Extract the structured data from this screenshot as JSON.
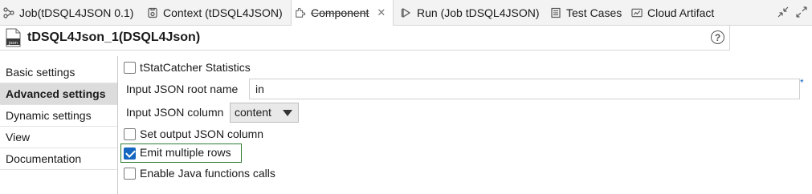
{
  "tabs": [
    {
      "label": "Job(tDSQL4JSON 0.1)",
      "icon": "job-icon",
      "active": false
    },
    {
      "label": "Context (tDSQL4JSON)",
      "icon": "context-icon",
      "active": false
    },
    {
      "label": "Component",
      "icon": "component-icon",
      "active": true
    },
    {
      "label": "Run (Job tDSQL4JSON)",
      "icon": "run-icon",
      "active": false
    },
    {
      "label": "Test Cases",
      "icon": "test-cases-icon",
      "active": false
    },
    {
      "label": "Cloud Artifact",
      "icon": "cloud-artifact-icon",
      "active": false
    }
  ],
  "tab_close": "✕",
  "component": {
    "title": "tDSQL4Json_1(DSQL4Json)",
    "icon_text": "DSQL",
    "help": "?"
  },
  "side_tabs": [
    {
      "label": "Basic settings",
      "active": false
    },
    {
      "label": "Advanced settings",
      "active": true
    },
    {
      "label": "Dynamic settings",
      "active": false
    },
    {
      "label": "View",
      "active": false
    },
    {
      "label": "Documentation",
      "active": false
    }
  ],
  "settings": {
    "tstatcatcher_label": "tStatCatcher Statistics",
    "tstatcatcher_checked": false,
    "root_name_label": "Input JSON root name",
    "root_name_value": "in",
    "required_marker": "*",
    "json_column_label": "Input JSON column",
    "json_column_value": "content",
    "set_output_label": "Set output JSON column",
    "set_output_checked": false,
    "emit_rows_label": "Emit multiple rows",
    "emit_rows_checked": true,
    "java_calls_label": "Enable Java functions calls",
    "java_calls_checked": false
  },
  "colors": {
    "accent": "#1566c0",
    "focus": "#2e7d32",
    "active_side_bg": "#dcdcdc"
  }
}
